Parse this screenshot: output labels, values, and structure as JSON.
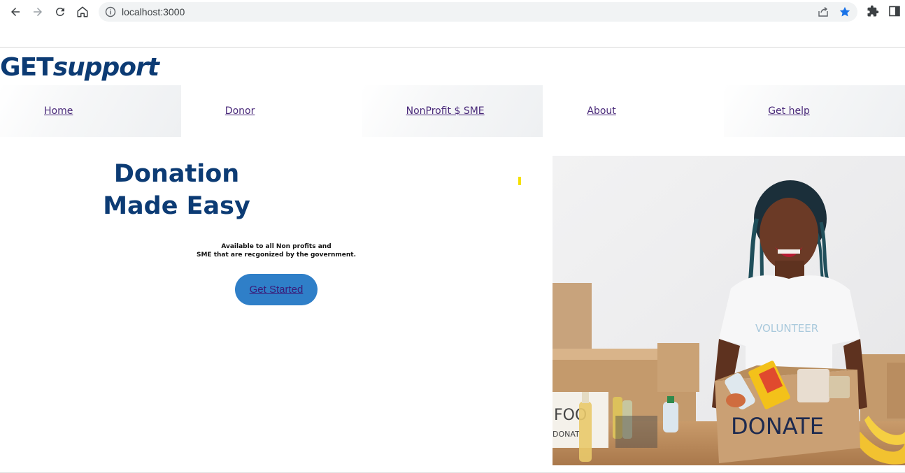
{
  "browser": {
    "url": "localhost:3000"
  },
  "logo": {
    "bold": "GET",
    "italic": "support"
  },
  "nav": {
    "items": [
      {
        "label": "Home"
      },
      {
        "label": "Donor"
      },
      {
        "label": "NonProfit $ SME"
      },
      {
        "label": "About"
      },
      {
        "label": "Get help"
      }
    ]
  },
  "hero": {
    "title_line1": "Donation",
    "title_line2": "Made Easy",
    "subtitle_line1": "Available to all Non profits and",
    "subtitle_line2": "SME that are recgonized by the government.",
    "cta_label": "Get Started",
    "photo": {
      "box_label": "DONATE",
      "shirt_label": "VOLUNTEER",
      "side_box_label_1": "FOO",
      "side_box_label_2": "DONAT"
    }
  },
  "colors": {
    "brand": "#0c3b74",
    "cta_bg": "#2f7fc8",
    "link": "#4a2a7a",
    "accent_star": "#1a73e8"
  },
  "icons": [
    "back-arrow-icon",
    "forward-arrow-icon",
    "reload-icon",
    "home-icon",
    "info-icon",
    "share-icon",
    "star-icon",
    "extensions-icon",
    "side-panel-icon"
  ]
}
